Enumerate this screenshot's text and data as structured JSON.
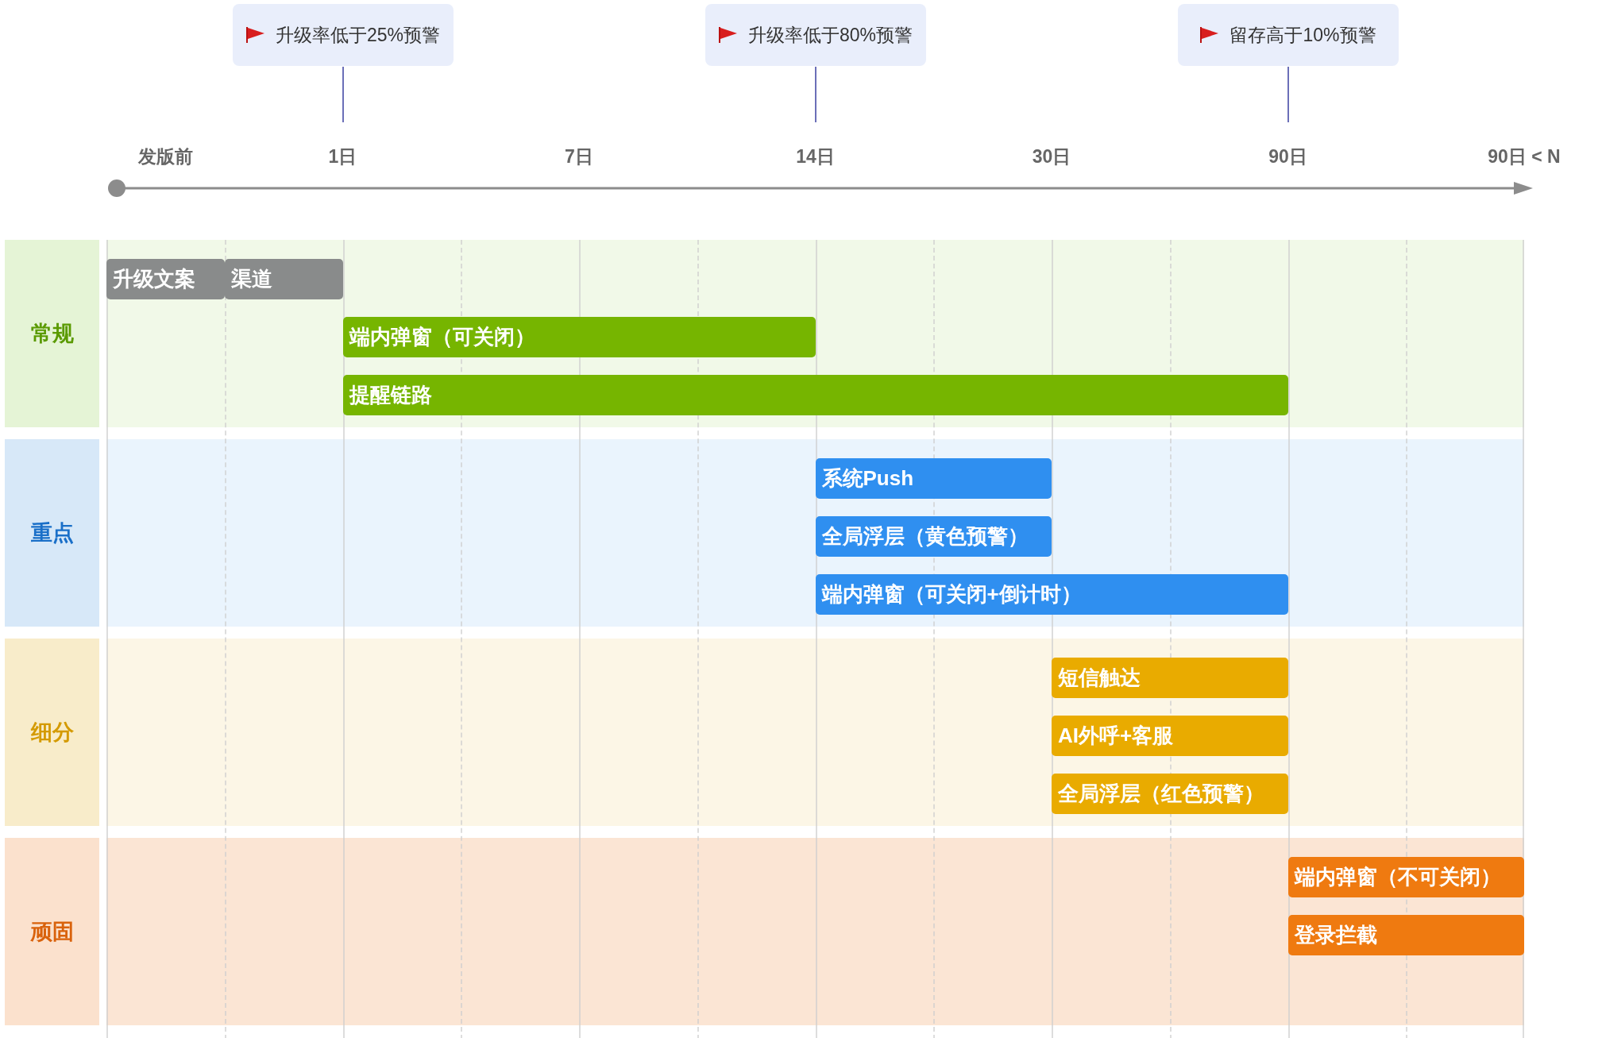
{
  "flags": [
    {
      "label": "升级率低于25%预警"
    },
    {
      "label": "升级率低于80%预警"
    },
    {
      "label": "留存高于10%预警"
    }
  ],
  "axis": {
    "ticks": [
      "发版前",
      "1日",
      "7日",
      "14日",
      "30日",
      "90日",
      "90日 < N"
    ]
  },
  "lanes": [
    {
      "label": "常规",
      "color": "#5a9a00",
      "rows": [
        [
          {
            "label": "升级文案",
            "color": "#898b8b"
          },
          {
            "label": "渠道",
            "color": "#898b8b"
          }
        ],
        [
          {
            "label": "端内弹窗（可关闭）",
            "color": "#76b500"
          }
        ],
        [
          {
            "label": "提醒链路",
            "color": "#76b500"
          }
        ]
      ]
    },
    {
      "label": "重点",
      "color": "#1a6fc8",
      "rows": [
        [
          {
            "label": "系统Push",
            "color": "#2f8ff0"
          }
        ],
        [
          {
            "label": "全局浮层（黄色预警）",
            "color": "#2f8ff0"
          }
        ],
        [
          {
            "label": "端内弹窗（可关闭+倒计时）",
            "color": "#2f8ff0"
          }
        ]
      ]
    },
    {
      "label": "细分",
      "color": "#d49a00",
      "rows": [
        [
          {
            "label": "短信触达",
            "color": "#e9ab00"
          }
        ],
        [
          {
            "label": "AI外呼+客服",
            "color": "#e9ab00"
          }
        ],
        [
          {
            "label": "全局浮层（红色预警）",
            "color": "#e9ab00"
          }
        ]
      ]
    },
    {
      "label": "顽固",
      "color": "#d9620c",
      "rows": [
        [
          {
            "label": "端内弹窗（不可关闭）",
            "color": "#ef7a10"
          }
        ],
        [
          {
            "label": "登录拦截",
            "color": "#ef7a10"
          }
        ]
      ]
    }
  ]
}
